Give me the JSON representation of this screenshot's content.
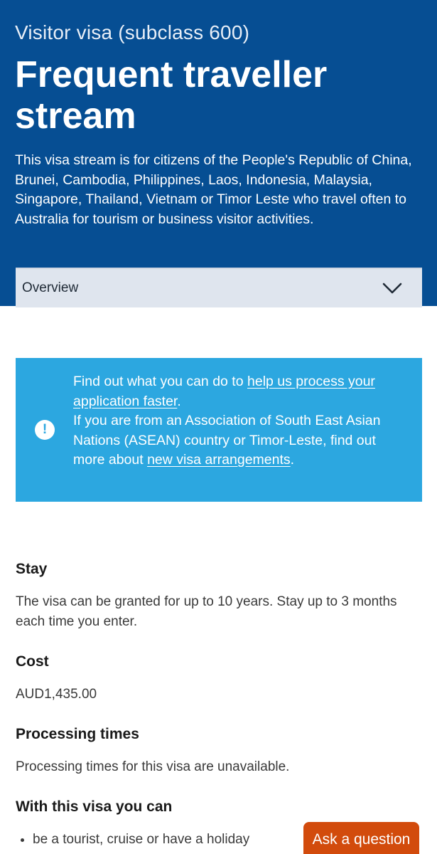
{
  "hero": {
    "subtitle": "Visitor visa (subclass 600)",
    "title": "Frequent traveller stream",
    "description": "This visa stream is for citizens of the People's Republic of China, Brunei, Cambodia, Philippines, Laos, Indonesia, Malaysia, Singapore, Thailand, Vietnam or Timor Leste who travel often to Australia for tourism or business visitor activities."
  },
  "nav_dropdown": {
    "selected": "Overview",
    "icon": "chevron-down-icon"
  },
  "notice": {
    "icon": "exclamation-icon",
    "line1_prefix": "Find out what you can do to ",
    "line1_link": "help us process your application faster",
    "line1_suffix": ".",
    "line2_prefix": "If you are from an Association of South East Asian Nations (ASEAN) country or Timor-Leste, find out more about ",
    "line2_link": "new visa arrangements",
    "line2_suffix": ".",
    "background_color": "#2ca7e0"
  },
  "sections": {
    "stay": {
      "heading": "Stay",
      "body": "The visa can be granted for up to 10 years. Stay up to 3 months each time you enter."
    },
    "cost": {
      "heading": "Cost",
      "body": "AUD1,435.00"
    },
    "processing": {
      "heading": "Processing times",
      "body": "Processing times for this visa are unavailable."
    },
    "abilities": {
      "heading": "With this visa you can",
      "items": [
        "be a tourist, cruise or have a holiday"
      ]
    }
  },
  "ask_button": {
    "label": "Ask a question",
    "color": "#d24b0c"
  },
  "colors": {
    "hero_background": "#064e93",
    "dropdown_background": "#dfe5ee"
  }
}
